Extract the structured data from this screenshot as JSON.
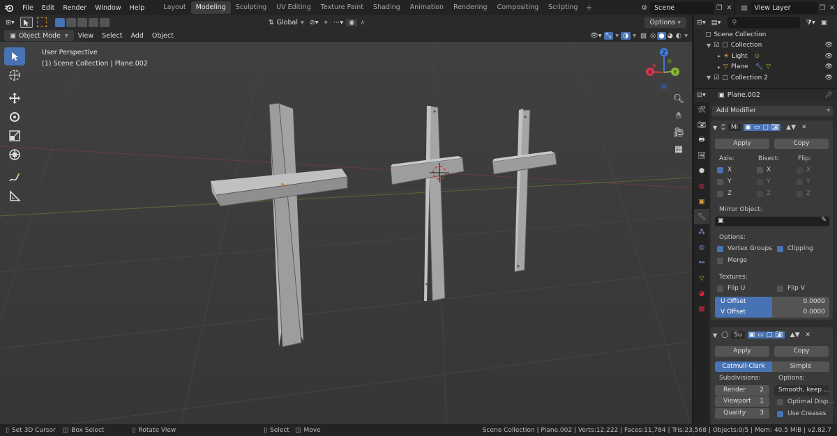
{
  "topbar": {
    "menus": [
      "File",
      "Edit",
      "Render",
      "Window",
      "Help"
    ],
    "workspaces": [
      "Layout",
      "Modeling",
      "Sculpting",
      "UV Editing",
      "Texture Paint",
      "Shading",
      "Animation",
      "Rendering",
      "Compositing",
      "Scripting"
    ],
    "active_workspace": "Modeling",
    "scene": "Scene",
    "view_layer": "View Layer"
  },
  "toolheader": {
    "transform_orientation": "Global",
    "options": "Options"
  },
  "viewport_header": {
    "mode": "Object Mode",
    "menus": [
      "View",
      "Select",
      "Add",
      "Object"
    ]
  },
  "viewport": {
    "perspective": "User Perspective",
    "collection_info": "(1) Scene Collection | Plane.002",
    "gizmo": {
      "z": "Z",
      "y": "Y",
      "x": "X"
    },
    "colors": {
      "bg": "#3b3b3b",
      "object": "#9a9a9a",
      "accent": "#4772b3"
    }
  },
  "outliner": {
    "root": "Scene Collection",
    "items": [
      {
        "label": "Collection",
        "indent": 1
      },
      {
        "label": "Light",
        "indent": 2
      },
      {
        "label": "Plane",
        "indent": 2
      },
      {
        "label": "Collection 2",
        "indent": 1
      }
    ]
  },
  "properties": {
    "object_name": "Plane.002",
    "add_modifier": "Add Modifier",
    "mirror": {
      "name": "Mi",
      "apply": "Apply",
      "copy": "Copy",
      "axis_label": "Axis:",
      "bisect_label": "Bisect:",
      "flip_label": "Flip:",
      "axes": [
        "X",
        "Y",
        "Z"
      ],
      "mirror_object_label": "Mirror Object:",
      "options_label": "Options:",
      "vertex_groups": "Vertex Groups",
      "clipping": "Clipping",
      "merge": "Merge",
      "textures_label": "Textures:",
      "flip_u": "Flip U",
      "flip_v": "Flip V",
      "u_offset_label": "U Offset",
      "u_offset": "0.0000",
      "v_offset_label": "V Offset",
      "v_offset": "0.0000"
    },
    "subsurf": {
      "name": "Su",
      "apply": "Apply",
      "copy": "Copy",
      "catmull": "Catmull-Clark",
      "simple": "Simple",
      "subdivisions_label": "Subdivisions:",
      "options_label": "Options:",
      "render_label": "Render",
      "render_val": "2",
      "viewport_label": "Viewport",
      "viewport_val": "1",
      "quality_label": "Quality",
      "quality_val": "3",
      "smooth": "Smooth, keep ...",
      "optimal": "Optimal Disp...",
      "use_creases": "Use Creases"
    }
  },
  "statusbar": {
    "set_cursor": "Set 3D Cursor",
    "box_select": "Box Select",
    "rotate_view": "Rotate View",
    "select": "Select",
    "move": "Move",
    "stats": "Scene Collection | Plane.002 | Verts:12,222 | Faces:11,784 | Tris:23,568 | Objects:0/5 | Mem: 40.5 MiB | v2.82.7"
  }
}
